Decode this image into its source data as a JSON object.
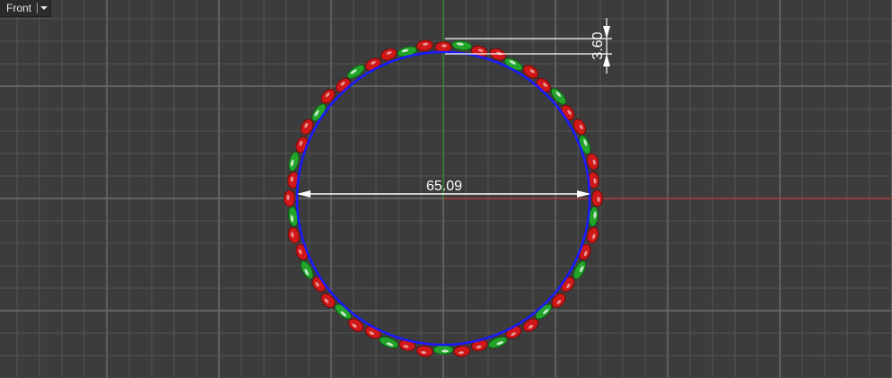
{
  "viewport": {
    "view_name": "Front",
    "menu_icon": "chevron-down-icon"
  },
  "dimensions": {
    "diameter_label": "65.09",
    "thickness_label": "3.60"
  },
  "colors": {
    "background": "#3c3c3c",
    "grid_minor": "#555555",
    "grid_major": "#6e6e6e",
    "axis_x": "#b03030",
    "axis_y": "#2e8b2e",
    "ring_curve": "#1a1aff",
    "stone_red": "#d01818",
    "stone_green": "#22a52a",
    "dimension": "#ffffff"
  }
}
